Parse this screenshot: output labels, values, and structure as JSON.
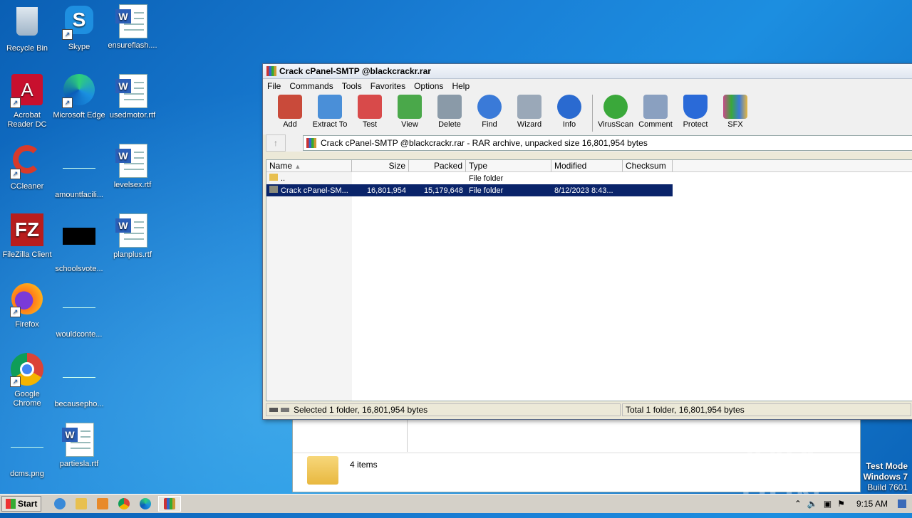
{
  "desktop": {
    "icons": [
      {
        "label": "Recycle Bin"
      },
      {
        "label": "Skype"
      },
      {
        "label": "ensureflash...."
      },
      {
        "label": "Acrobat Reader DC"
      },
      {
        "label": "Microsoft Edge"
      },
      {
        "label": "usedmotor.rtf"
      },
      {
        "label": "CCleaner"
      },
      {
        "label": "amountfacili..."
      },
      {
        "label": "levelsex.rtf"
      },
      {
        "label": "FileZilla Client"
      },
      {
        "label": "schoolsvote..."
      },
      {
        "label": "planplus.rtf"
      },
      {
        "label": "Firefox"
      },
      {
        "label": "wouldconte..."
      },
      {
        "label": "Google Chrome"
      },
      {
        "label": "becausepho..."
      },
      {
        "label": "dcms.png"
      },
      {
        "label": "partiesla.rtf"
      }
    ]
  },
  "winrar": {
    "title": "Crack cPanel-SMTP @blackcrackr.rar",
    "menu": [
      "File",
      "Commands",
      "Tools",
      "Favorites",
      "Options",
      "Help"
    ],
    "toolbar": [
      {
        "label": "Add",
        "color": "#c94a3a"
      },
      {
        "label": "Extract To",
        "color": "#4a8fd8"
      },
      {
        "label": "Test",
        "color": "#d84a4a"
      },
      {
        "label": "View",
        "color": "#4aa84a"
      },
      {
        "label": "Delete",
        "color": "#8a9aa8"
      },
      {
        "label": "Find",
        "color": "#3a7ad8"
      },
      {
        "label": "Wizard",
        "color": "#9aa8b8"
      },
      {
        "label": "Info",
        "color": "#2a6ad0"
      },
      {
        "label": "VirusScan",
        "color": "#3aa83a"
      },
      {
        "label": "Comment",
        "color": "#8aa0c0"
      },
      {
        "label": "Protect",
        "color": "#2a6ad8"
      },
      {
        "label": "SFX",
        "color": "#c84a8a"
      }
    ],
    "address": "Crack cPanel-SMTP @blackcrackr.rar - RAR archive, unpacked size 16,801,954 bytes",
    "columns": [
      "Name",
      "Size",
      "Packed",
      "Type",
      "Modified",
      "Checksum"
    ],
    "rows": [
      {
        "name": "..",
        "size": "",
        "packed": "",
        "type": "File folder",
        "modified": "",
        "checksum": ""
      },
      {
        "name": "Crack cPanel-SM...",
        "size": "16,801,954",
        "packed": "15,179,648",
        "type": "File folder",
        "modified": "8/12/2023 8:43...",
        "checksum": ""
      }
    ],
    "status_left": "Selected 1 folder, 16,801,954 bytes",
    "status_right": "Total 1 folder, 16,801,954 bytes"
  },
  "explorer": {
    "items": "4 items"
  },
  "testmode": {
    "line1": "Test Mode",
    "line2": "Windows 7",
    "line3": "Build 7601"
  },
  "watermark": "ANY RUN",
  "taskbar": {
    "start": "Start",
    "clock": "9:15 AM"
  }
}
